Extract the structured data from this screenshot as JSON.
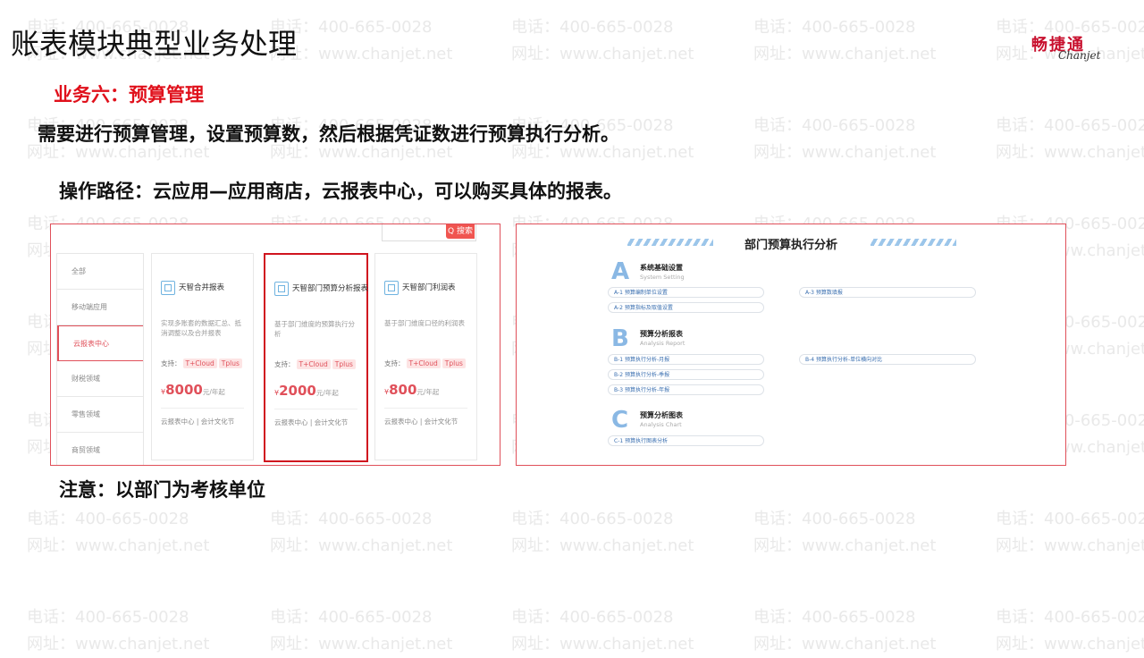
{
  "title": "账表模块典型业务处理",
  "logo": {
    "cn": "畅捷通",
    "en": "Chanjet"
  },
  "watermark": {
    "phone": "电话：400-665-0028",
    "site": "网址：www.chanjet.net"
  },
  "subtitle": "业务六：预算管理",
  "description": "需要进行预算管理，设置预算数，然后根据凭证数进行预算执行分析。",
  "path": "操作路径：云应用—应用商店，云报表中心，可以购买具体的报表。",
  "note": "注意：以部门为考核单位",
  "store": {
    "search_label": "Q 搜索",
    "categories": [
      "全部",
      "移动端应用",
      "云报表中心",
      "财税领域",
      "零售领域",
      "商贸领域"
    ],
    "cards": [
      {
        "title": "天智合并报表",
        "desc": "实现多账套的数据汇总、抵消调整以及合并报表",
        "support": "支持：",
        "tag1": "T+Cloud",
        "tag2": "Tplus",
        "currency": "¥",
        "price": "8000",
        "unit": "元/年起",
        "footer": "云报表中心 | 会计文化节"
      },
      {
        "title": "天智部门预算分析报表",
        "desc": "基于部门维度的预算执行分析",
        "support": "支持：",
        "tag1": "T+Cloud",
        "tag2": "Tplus",
        "currency": "¥",
        "price": "2000",
        "unit": "元/年起",
        "footer": "云报表中心 | 会计文化节"
      },
      {
        "title": "天智部门利润表",
        "desc": "基于部门维度口径的利润表",
        "support": "支持：",
        "tag1": "T+Cloud",
        "tag2": "Tplus",
        "currency": "¥",
        "price": "800",
        "unit": "元/年起",
        "footer": "云报表中心 | 会计文化节"
      }
    ]
  },
  "analysis": {
    "title": "部门预算执行分析",
    "sections": [
      {
        "letter": "A",
        "title": "系统基础设置",
        "sub": "System Setting",
        "items": [
          "A-1 预算编制单位设置",
          "A-2 预算指标及取值设置",
          "A-3 预算数填报"
        ]
      },
      {
        "letter": "B",
        "title": "预算分析报表",
        "sub": "Analysis Report",
        "items": [
          "B-1 预算执行分析-月报",
          "B-2 预算执行分析-季报",
          "B-3 预算执行分析-年报",
          "B-4 预算执行分析-单位横向对比"
        ]
      },
      {
        "letter": "C",
        "title": "预算分析图表",
        "sub": "Analysis Chart",
        "items": [
          "C-1 预算执行图表分析"
        ]
      }
    ]
  },
  "colors": {
    "accent": "#e0101b",
    "border": "#e0505a",
    "blue": "#8ab8e4"
  }
}
